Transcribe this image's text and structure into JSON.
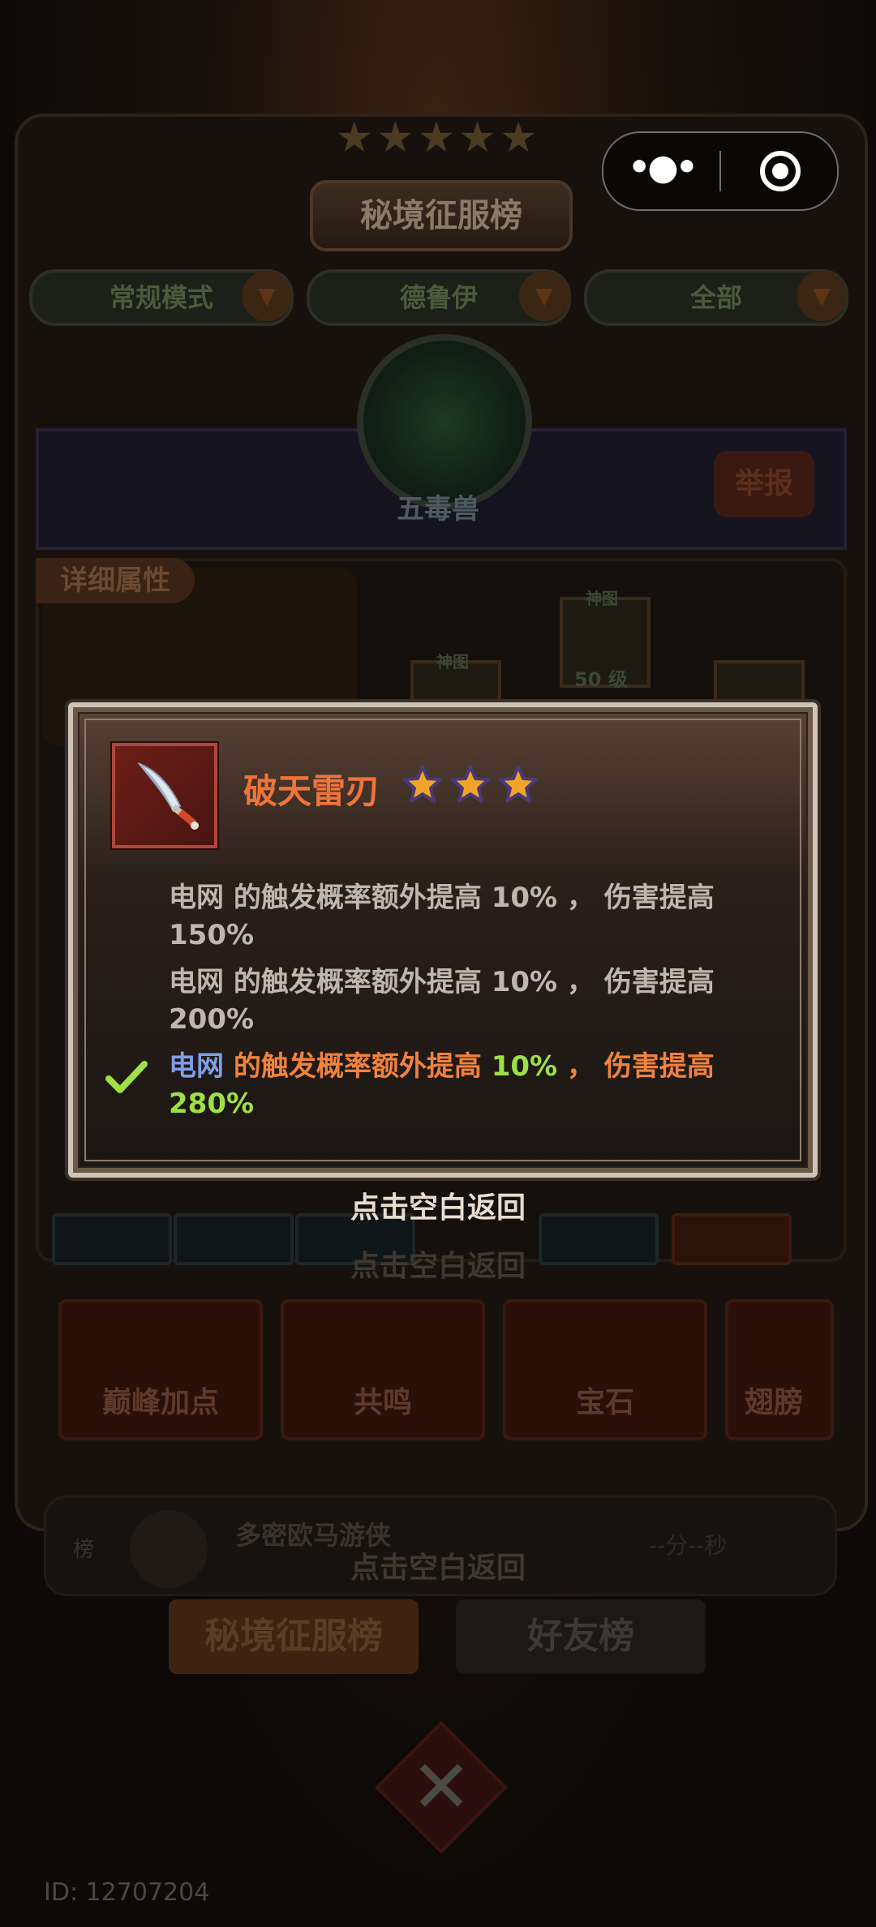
{
  "capsule": {
    "more_icon": "ellipsis-icon",
    "target_icon": "target-icon"
  },
  "background": {
    "title": "秘境征服榜",
    "filters": [
      {
        "label": "常规模式"
      },
      {
        "label": "德鲁伊"
      },
      {
        "label": "全部"
      }
    ],
    "hero_name": "五毒兽",
    "report_label": "举报",
    "detail_tag": "详细属性",
    "slots": [
      {
        "label": "神图",
        "level": ""
      },
      {
        "label": "神图",
        "level": "50 级"
      }
    ],
    "bottom_buttons": [
      "巅峰加点",
      "共鸣",
      "宝石",
      "翅膀"
    ],
    "ghost_return_1": "点击空白返回",
    "ghost_return_2": "点击空白返回",
    "leaderboard_row": {
      "name": "多密欧马游侠",
      "time": "--分--秒",
      "rank_label": "榜"
    },
    "tabs": [
      "秘境征服榜",
      "好友榜"
    ],
    "player_id": "ID: 12707204"
  },
  "modal": {
    "item_name": "破天雷刃",
    "star_count": 3,
    "lines": [
      {
        "name": "电网",
        "text": " 的触发概率额外提高 ",
        "prob": "10%",
        "sep": "，",
        "text2": "伤害提高",
        "dmg": "150%",
        "active": false
      },
      {
        "name": "电网",
        "text": " 的触发概率额外提高 ",
        "prob": "10%",
        "sep": "，",
        "text2": "伤害提高",
        "dmg": "200%",
        "active": false
      },
      {
        "name": "电网",
        "text": " 的触发概率额外提高 ",
        "prob": "10%",
        "sep": "，",
        "text2": "伤害提高",
        "dmg": "280%",
        "active": true
      }
    ]
  },
  "return_hint": "点击空白返回",
  "colors": {
    "item_name": "#f0743a",
    "active_name": "#7f9fe8",
    "active_text": "#f0823e",
    "active_value": "#9ee045",
    "inactive_text": "#bfb7ad"
  }
}
